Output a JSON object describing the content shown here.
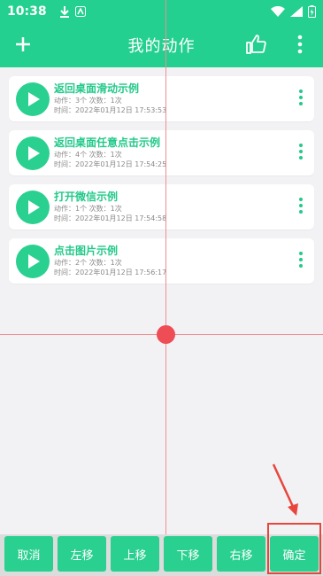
{
  "status_bar": {
    "time": "10:38",
    "icons_left": [
      "download-icon",
      "app-badge-icon"
    ],
    "icons_right": [
      "wifi-icon",
      "signal-icon",
      "battery-icon"
    ]
  },
  "app_bar": {
    "title": "我的动作",
    "left_icon": "plus-icon",
    "right_icons": [
      "thumbs-up-icon",
      "more-vertical-icon"
    ]
  },
  "actions": [
    {
      "name": "返回桌面滑动示例",
      "meta": "动作：3个 次数：1次",
      "time": "时间：2022年01月12日 17:53:53"
    },
    {
      "name": "返回桌面任意点击示例",
      "meta": "动作：4个 次数：1次",
      "time": "时间：2022年01月12日 17:54:25"
    },
    {
      "name": "打开微信示例",
      "meta": "动作：1个 次数：1次",
      "time": "时间：2022年01月12日 17:54:58"
    },
    {
      "name": "点击图片示例",
      "meta": "动作：2个 次数：1次",
      "time": "时间：2022年01月12日 17:56:17"
    }
  ],
  "bottom_buttons": [
    "取消",
    "左移",
    "上移",
    "下移",
    "右移",
    "确定"
  ],
  "colors": {
    "accent": "#23d08f",
    "crosshair": "#f08e92",
    "target_dot": "#ee4d55",
    "annotation": "#e8453c"
  }
}
